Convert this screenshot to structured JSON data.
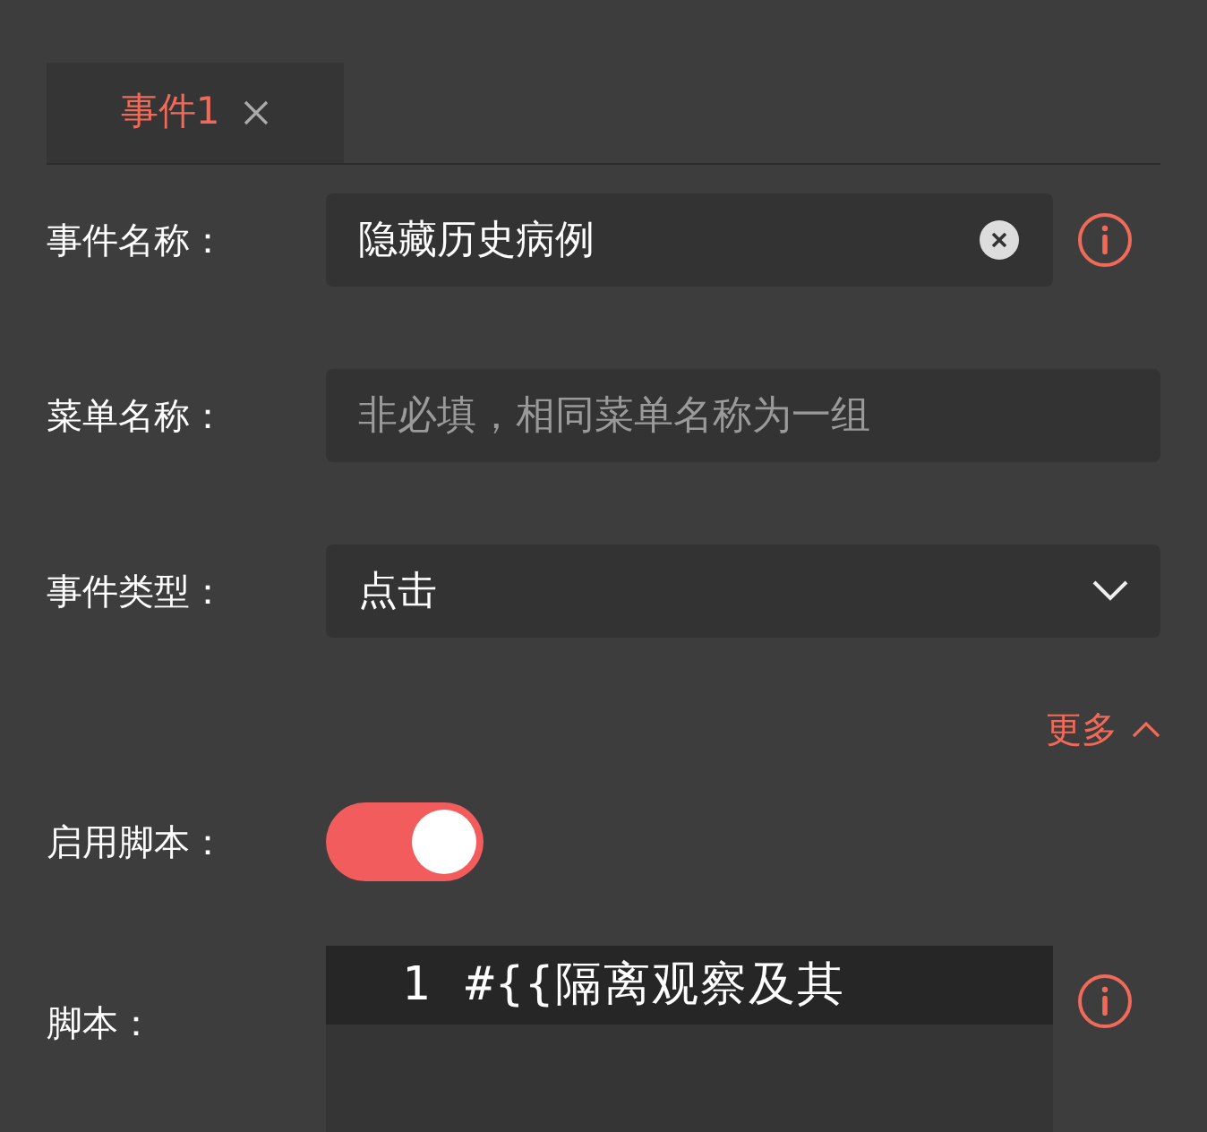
{
  "tabs": [
    {
      "label": "事件1",
      "selected": true
    }
  ],
  "fields": [
    {
      "kind": "text",
      "label": "事件名称：",
      "value": "隐藏历史病例",
      "clearable": true,
      "info": true
    },
    {
      "kind": "text",
      "label": "菜单名称：",
      "placeholder": "非必填，相同菜单名称为一组",
      "clearable": false,
      "info": false
    },
    {
      "kind": "select",
      "label": "事件类型：",
      "value": "点击",
      "clearable": false,
      "info": false
    }
  ],
  "more": {
    "label": "更多",
    "expanded": true
  },
  "script_toggle": {
    "label": "启用脚本：",
    "on": true
  },
  "script": {
    "label": "脚本：",
    "lines": [
      {
        "number": "1",
        "code": "#{{隔离观察及其"
      }
    ],
    "info": true
  }
}
